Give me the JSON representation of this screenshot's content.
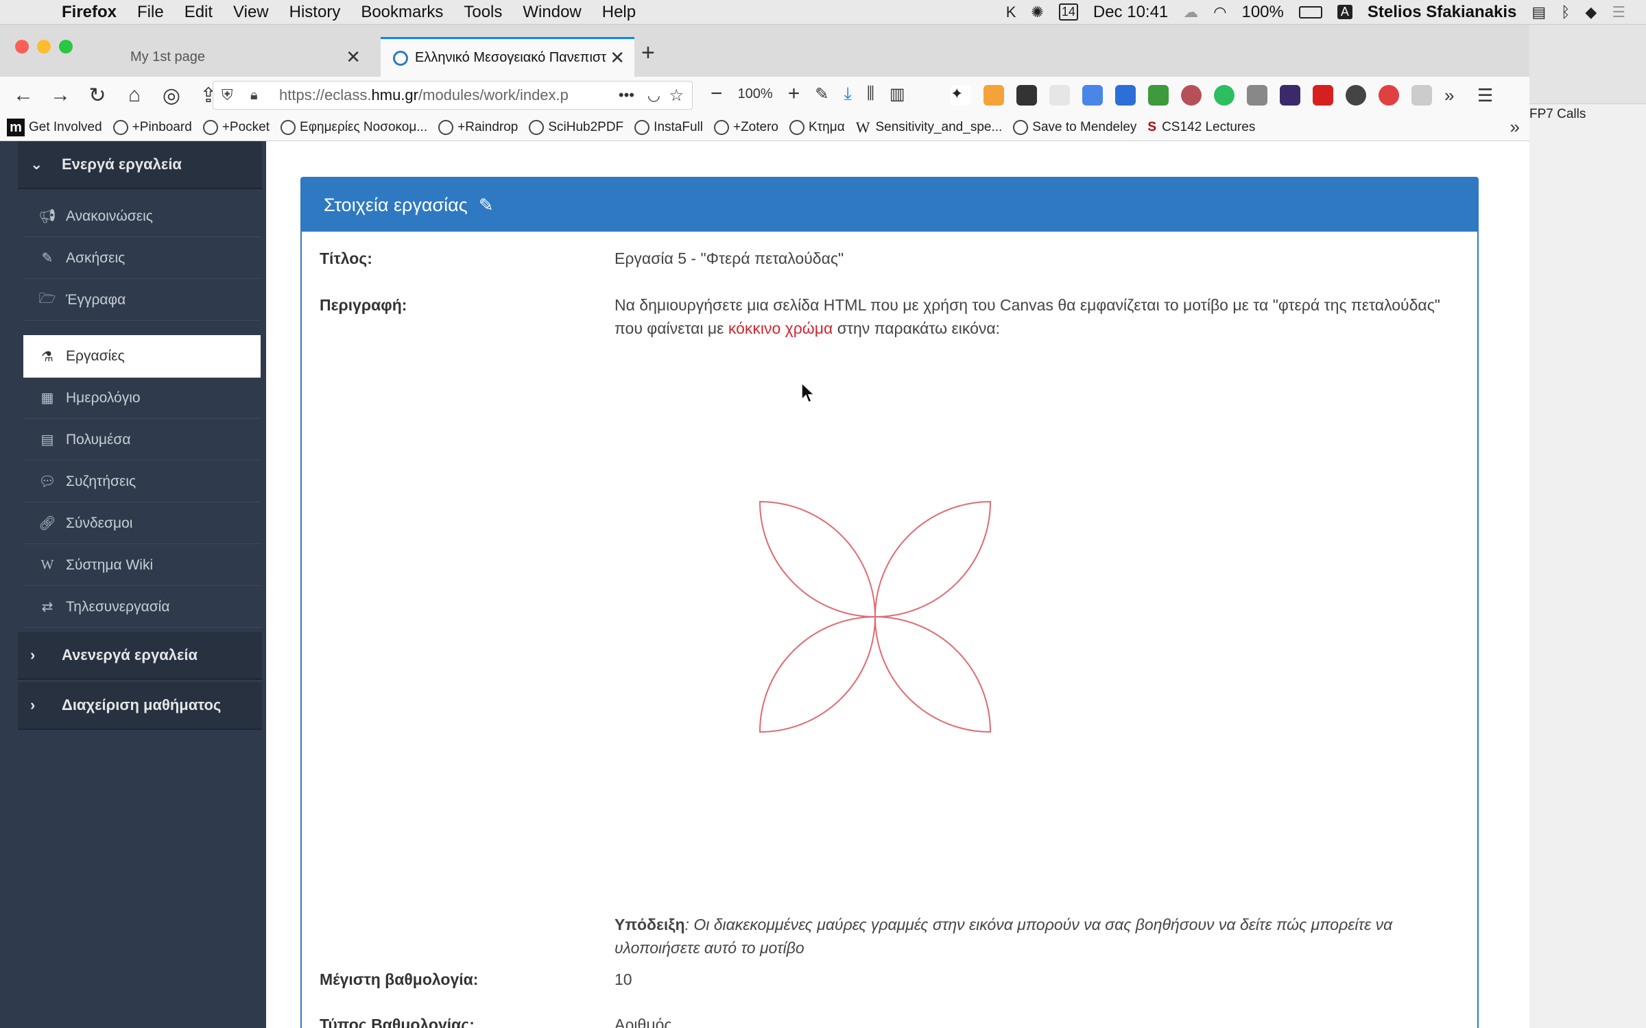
{
  "menubar": {
    "app": "Firefox",
    "menus": [
      "File",
      "Edit",
      "View",
      "History",
      "Bookmarks",
      "Tools",
      "Window",
      "Help"
    ],
    "clock": "Dec 10:41",
    "calendar_day": "14",
    "battery": "100%",
    "input_source": "A",
    "user": "Stelios Sfakianakis"
  },
  "tabs": [
    {
      "title": "My 1st page"
    },
    {
      "title": "Ελληνικό Μεσογειακό Πανεπιστ"
    }
  ],
  "url": {
    "prefix": "https://eclass.",
    "host": "hmu.gr",
    "path": "/modules/work/index.p"
  },
  "zoom": "100%",
  "bookmarks": [
    "Get Involved",
    "+Pinboard",
    "+Pocket",
    "Εφημερίες Νοσοκομ...",
    "+Raindrop",
    "SciHub2PDF",
    "InstaFull",
    "+Zotero",
    "Κτημα",
    "Sensitivity_and_spe...",
    "Save to Mendeley",
    "CS142 Lectures"
  ],
  "outside_bookmark": "FP7 Calls",
  "sidebar": {
    "active_tools": "Ενεργά εργαλεία",
    "items": [
      {
        "label": "Ανακοινώσεις",
        "icon": "megaphone-icon"
      },
      {
        "label": "Ασκήσεις",
        "icon": "edit-icon"
      },
      {
        "label": "Έγγραφα",
        "icon": "folder-icon"
      },
      {
        "label": "Εργασίες",
        "icon": "flask-icon"
      },
      {
        "label": "Ημερολόγιο",
        "icon": "calendar-icon"
      },
      {
        "label": "Πολυμέσα",
        "icon": "film-icon"
      },
      {
        "label": "Συζητήσεις",
        "icon": "comments-icon"
      },
      {
        "label": "Σύνδεσμοι",
        "icon": "link-icon"
      },
      {
        "label": "Σύστημα Wiki",
        "icon": "wiki-icon"
      },
      {
        "label": "Τηλεσυνεργασία",
        "icon": "exchange-icon"
      }
    ],
    "inactive_tools": "Ανενεργά εργαλεία",
    "course_admin": "Διαχείριση μαθήματος"
  },
  "panel": {
    "title": "Στοιχεία εργασίας",
    "title_label": "Τίτλος:",
    "title_value": "Εργασία 5 - \"Φτερά πεταλούδας\"",
    "desc_label": "Περιγραφή:",
    "desc_part1": "Να δημιουργήσετε μια σελίδα HTML που με χρήση του Canvas θα εμφανίζεται το μοτίβο με τα \"φτερά της πεταλούδας\" που φαίνεται με ",
    "desc_red": "κόκκινο χρώμα",
    "desc_part2": " στην παρακάτω εικόνα:",
    "hint_label": "Υπόδειξη",
    "hint_text": ": Οι διακεκομμένες μαύρες γραμμές στην εικόνα μπορούν να σας βοηθήσουν να δείτε πώς μπορείτε να υλοποιήσετε αυτό το μοτίβο",
    "max_grade_label": "Μέγιστη βαθμολογία:",
    "max_grade_value": "10",
    "grade_type_label": "Τύπος Βαθμολογίας:",
    "grade_type_value": "Αριθμός"
  },
  "colors": {
    "panel_header": "#2f79c2",
    "sidebar_bg": "#2f3b4c",
    "highlight_red": "#d0262e",
    "butterfly_stroke": "#e06a70"
  }
}
